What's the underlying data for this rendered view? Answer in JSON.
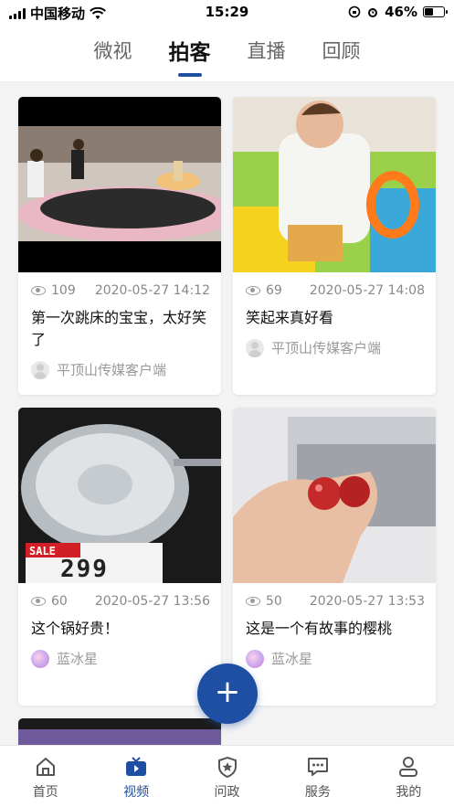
{
  "status_bar": {
    "carrier": "中国移动",
    "time": "15:29",
    "battery_percent": "46%",
    "battery_level": 0.46
  },
  "top_tabs": [
    {
      "label": "微视",
      "active": false
    },
    {
      "label": "拍客",
      "active": true
    },
    {
      "label": "直播",
      "active": false
    },
    {
      "label": "回顾",
      "active": false
    }
  ],
  "cards": [
    {
      "views": "109",
      "date": "2020-05-27 14:12",
      "title": "第一次跳床的宝宝，太好笑了",
      "author": "平顶山传媒客户端"
    },
    {
      "views": "69",
      "date": "2020-05-27 14:08",
      "title": "笑起来真好看",
      "author": "平顶山传媒客户端"
    },
    {
      "views": "60",
      "date": "2020-05-27 13:56",
      "title": "这个锅好贵！",
      "author": "蓝冰星"
    },
    {
      "views": "50",
      "date": "2020-05-27 13:53",
      "title": "这是一个有故事的樱桃",
      "author": "蓝冰星"
    }
  ],
  "price_tag": {
    "label": "SALE",
    "price": "299"
  },
  "fab": {
    "label": "+"
  },
  "bottom_nav": [
    {
      "label": "首页",
      "icon": "home-icon",
      "active": false
    },
    {
      "label": "视频",
      "icon": "tv-icon",
      "active": true
    },
    {
      "label": "问政",
      "icon": "shield-star-icon",
      "active": false
    },
    {
      "label": "服务",
      "icon": "chat-icon",
      "active": false
    },
    {
      "label": "我的",
      "icon": "user-icon",
      "active": false
    }
  ],
  "colors": {
    "accent": "#1e4fa3",
    "background": "#f3f3f3"
  }
}
